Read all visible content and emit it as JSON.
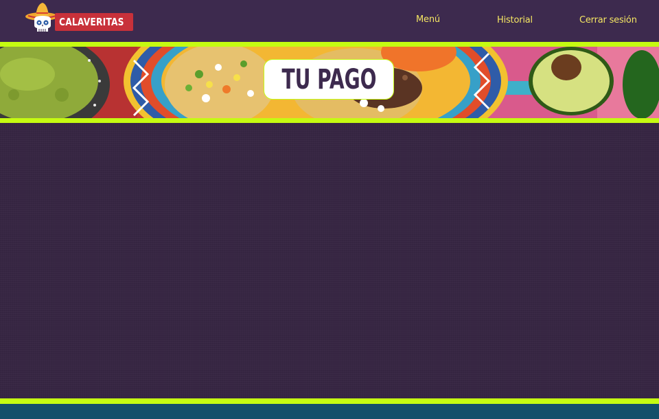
{
  "header": {
    "logo_text": "CALAVERITAS",
    "nav": {
      "menu": "Menú",
      "historial": "Historial",
      "logout": "Cerrar sesión"
    }
  },
  "banner": {
    "title": "TU PAGO"
  },
  "colors": {
    "header_bg": "#3d2a4e",
    "accent_lime": "#c5fb12",
    "nav_text": "#f5e663",
    "main_bg": "#372643",
    "footer_bg": "#134f6a",
    "logo_red": "#c8313a"
  },
  "icons": {
    "logo": "skull-sombrero-icon"
  }
}
